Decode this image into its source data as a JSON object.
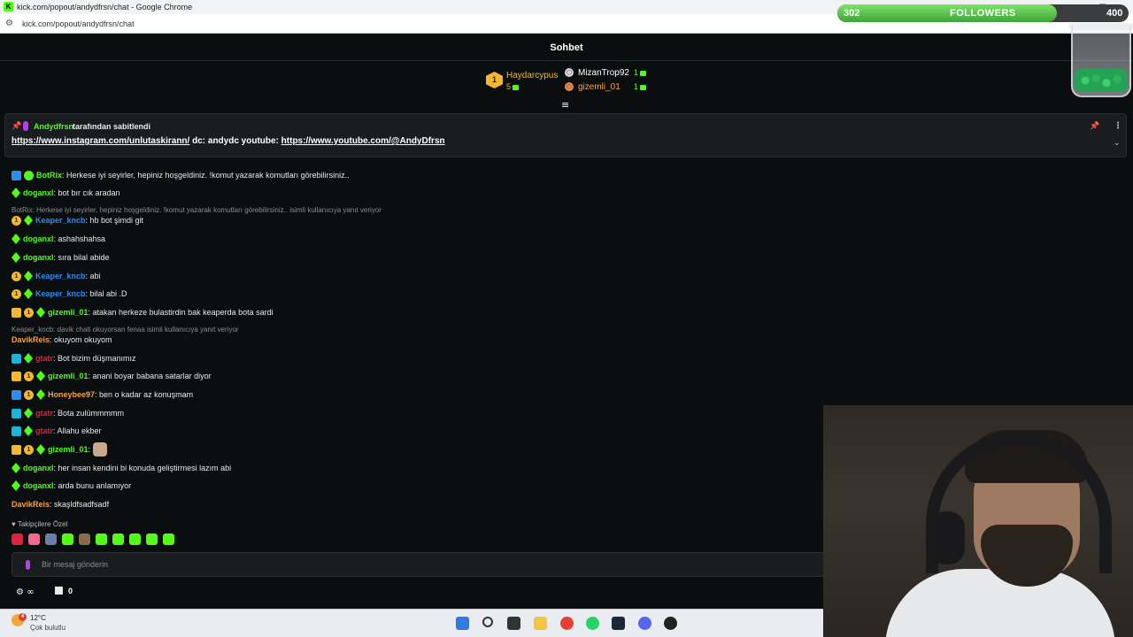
{
  "window": {
    "title": "kick.com/popout/andydfrsn/chat - Google Chrome",
    "url": "kick.com/popout/andydfrsn/chat",
    "favicon": "K"
  },
  "chat": {
    "title": "Sohbet"
  },
  "leaderboard": {
    "first": {
      "rank": "1",
      "name": "Haydarcypus",
      "count": "5"
    },
    "second": {
      "name": "MizanTrop92",
      "count": "1"
    },
    "third": {
      "name": "gizemli_01",
      "count": "1"
    }
  },
  "pinned": {
    "by_name": "Andydfrsn",
    "by_text": "tarafından sabitlendi",
    "link1": "https://www.instagram.com/unlutaskirann/",
    "middle": " dc: andydc youtube: ",
    "link2": "https://www.youtube.com/@AndyDfrsn"
  },
  "messages": [
    {
      "user": "BotRix",
      "text": ": Herkese iyi seyirler, hepiniz hoşgeldiniz. !komut yazarak komutları görebilirsiniz..",
      "color": "#53fc18"
    },
    {
      "user": "doganxl",
      "text": ": bot bır cık aradan",
      "color": "#53fc18"
    },
    {
      "user": "Keaper_kncb",
      "text": ": hb bot şimdi git",
      "color": "#2a8ef5",
      "reply": "BotRix: Herkese iyi seyirler, hepiniz hoşgeldiniz. !komut yazarak komutları görebilirsiniz.. isimli kullanıcıya yanıt veriyor"
    },
    {
      "user": "doganxl",
      "text": ": ashahshahsa",
      "color": "#53fc18"
    },
    {
      "user": "doganxl",
      "text": ": sıra bilal abide",
      "color": "#53fc18"
    },
    {
      "user": "Keaper_kncb",
      "text": ": abi",
      "color": "#2a8ef5"
    },
    {
      "user": "Keaper_kncb",
      "text": ": bilal abi .D",
      "color": "#2a8ef5"
    },
    {
      "user": "gizemli_01",
      "text": ": atakan herkeze bulastirdin bak keaperda bota sardi",
      "color": "#53fc18"
    },
    {
      "user": "DavikReis",
      "text": ": okuyom okuyom",
      "color": "#f5a24b",
      "reply": "Keaper_kncb: davik chati okuyorsan fenaa isimli kullanıcıya yanıt veriyor"
    },
    {
      "user": "gtatr",
      "text": ": Bot bizim düşmanımız",
      "color": "#e0213b"
    },
    {
      "user": "gizemli_01",
      "text": ": anani boyar babana satarlar diyor",
      "color": "#53fc18"
    },
    {
      "user": "Honeybee97",
      "text": ": ben o kadar az konuşmam",
      "color": "#f5a24b"
    },
    {
      "user": "gtatr",
      "text": ": Bota zulümmmmm",
      "color": "#e0213b"
    },
    {
      "user": "gtatr",
      "text": ": Allahu ekber",
      "color": "#e0213b"
    },
    {
      "user": "gizemli_01",
      "text": ":",
      "color": "#53fc18"
    },
    {
      "user": "doganxl",
      "text": ": her insan kendini bi konuda geliştirmesi lazım abi",
      "color": "#53fc18"
    },
    {
      "user": "doganxl",
      "text": ": arda bunu anlamıyor",
      "color": "#53fc18"
    },
    {
      "user": "DavikReis",
      "text": ": skaşldfsadfsadf",
      "color": "#f5a24b"
    }
  ],
  "footer": {
    "followers_only": "♥ Takipçilere Özel",
    "input_placeholder": "Bir mesaj gönderin",
    "infinity": "∞",
    "count": "0"
  },
  "taskbar": {
    "temp": "12°C",
    "weather": "Çok bulutlu",
    "weather_badge": "4"
  },
  "overlay": {
    "followers_current": "302",
    "followers_label": "FOLLOWERS",
    "followers_goal": "400",
    "progress_fraction": 0.755
  },
  "colors": {
    "accent": "#53fc18",
    "background": "#0b0e0f"
  }
}
